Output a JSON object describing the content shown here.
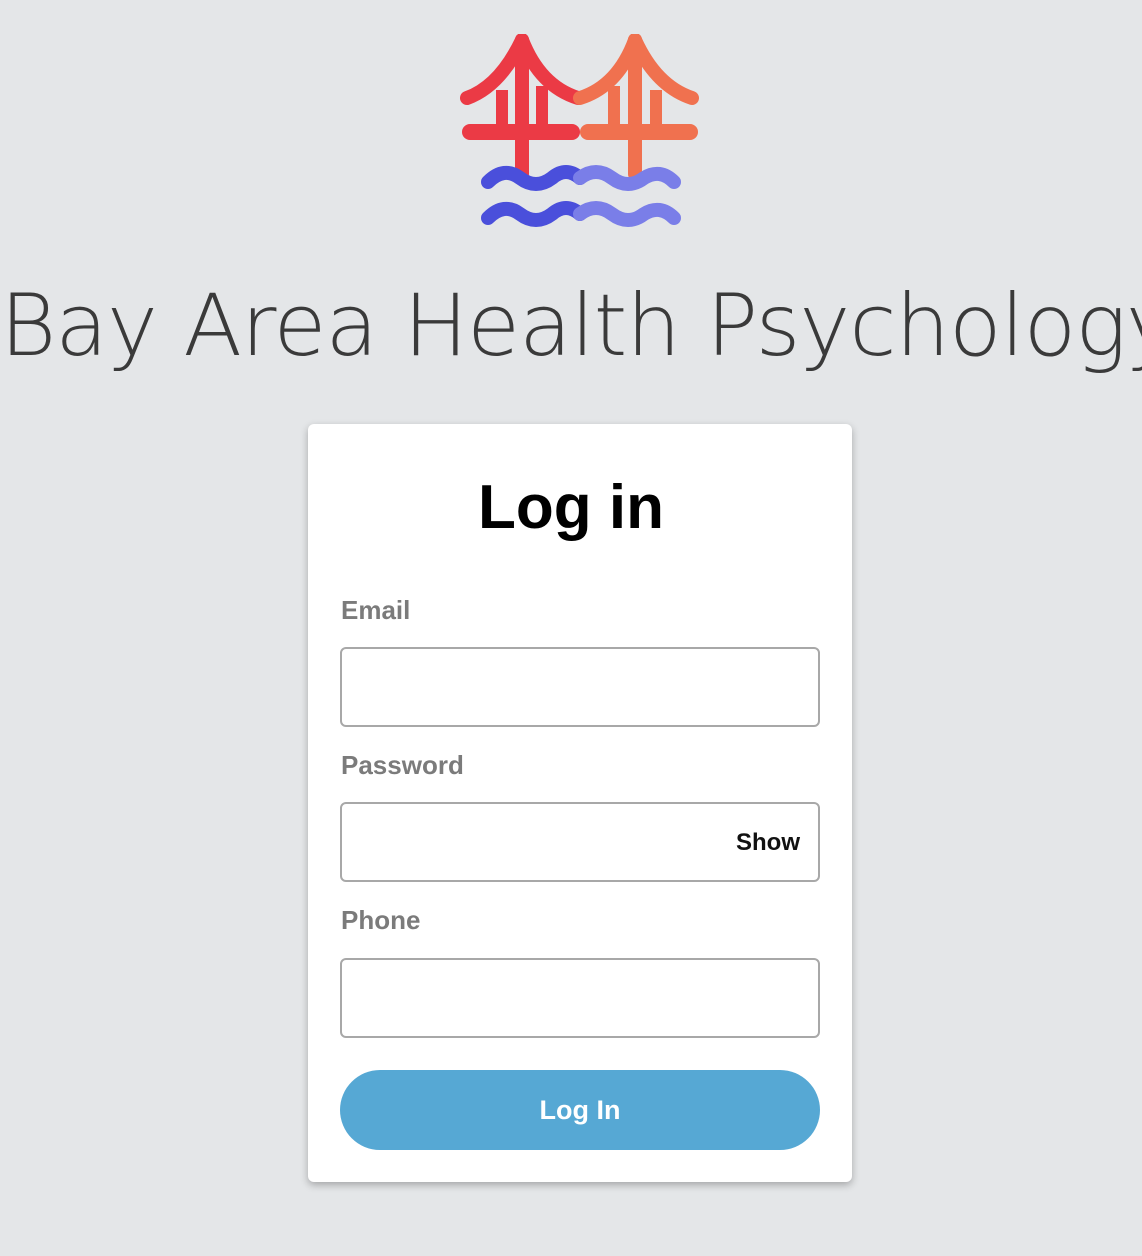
{
  "brand": {
    "name": "Bay Area Health Psychology",
    "logo_icon": "golden-gate-bridge-waves-logo",
    "colors": {
      "bridge_left": "#eb3a45",
      "bridge_right": "#f0714f",
      "wave_left": "#4a4fdb",
      "wave_right": "#7a7ee8"
    }
  },
  "login": {
    "title": "Log in",
    "email_label": "Email",
    "email_value": "",
    "password_label": "Password",
    "password_value": "",
    "show_label": "Show",
    "phone_label": "Phone",
    "phone_value": "",
    "submit_label": "Log In",
    "submit_color": "#56a8d4"
  }
}
